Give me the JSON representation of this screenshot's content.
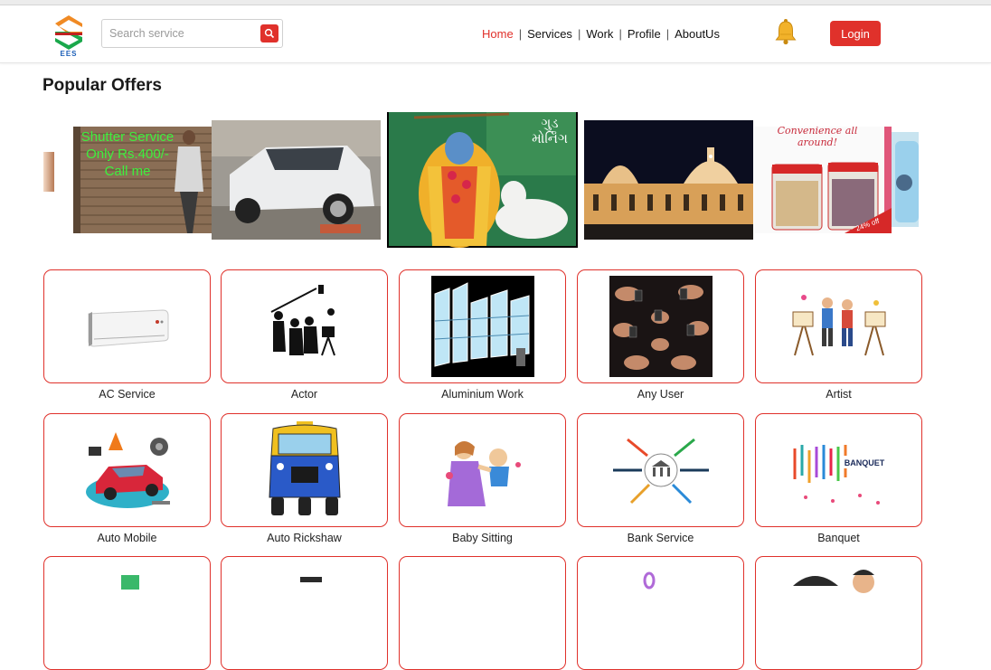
{
  "header": {
    "logo_text": "EES",
    "search": {
      "placeholder": "Search service",
      "value": ""
    },
    "nav": [
      "Home",
      "Services",
      "Work",
      "Profile",
      "AboutUs"
    ],
    "nav_active": "Home",
    "login_label": "Login"
  },
  "offers": {
    "title": "Popular Offers",
    "shutter_ad_text": "Shutter Service Only Rs.400/- Call me",
    "greeting_text": "ગુડ મોર્નિંગ",
    "convenience_text": "Convenience all around!",
    "sale_tag": "24% off"
  },
  "services": [
    {
      "name": "AC Service",
      "icon": "ac-unit-icon"
    },
    {
      "name": "Actor",
      "icon": "film-crew-icon"
    },
    {
      "name": "Aluminium Work",
      "icon": "aluminium-windows-icon"
    },
    {
      "name": "Any User",
      "icon": "phones-hands-icon"
    },
    {
      "name": "Artist",
      "icon": "painters-icon"
    },
    {
      "name": "Auto Mobile",
      "icon": "car-repair-icon"
    },
    {
      "name": "Auto Rickshaw",
      "icon": "rickshaw-icon"
    },
    {
      "name": "Baby Sitting",
      "icon": "baby-sitting-icon"
    },
    {
      "name": "Bank Service",
      "icon": "bank-icon"
    },
    {
      "name": "Banquet",
      "icon": "banquet-icon"
    }
  ],
  "colors": {
    "accent": "#e0312b",
    "logo_green": "#1aa84b",
    "logo_orange": "#f08a24"
  }
}
